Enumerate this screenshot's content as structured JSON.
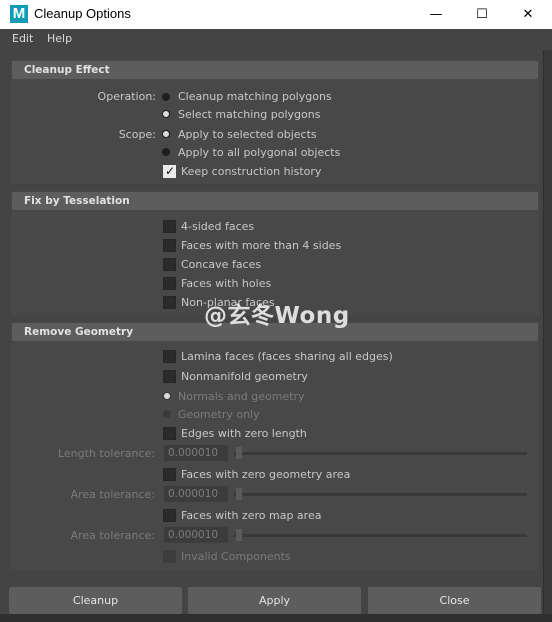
{
  "window": {
    "app_icon_letter": "M",
    "title": "Cleanup Options",
    "minimize_glyph": "—",
    "maximize_glyph": "☐",
    "close_glyph": "✕"
  },
  "menu": {
    "edit": "Edit",
    "help": "Help"
  },
  "cleanup_effect": {
    "header": "Cleanup Effect",
    "operation_label": "Operation:",
    "operation_options": [
      {
        "label": "Cleanup matching polygons",
        "selected": false
      },
      {
        "label": "Select matching polygons",
        "selected": true
      }
    ],
    "scope_label": "Scope:",
    "scope_options": [
      {
        "label": "Apply to selected objects",
        "selected": true
      },
      {
        "label": "Apply to all polygonal objects",
        "selected": false
      }
    ],
    "keep_history": {
      "label": "Keep construction history",
      "checked": true
    }
  },
  "fix_by_tesselation": {
    "header": "Fix by Tesselation",
    "options": [
      {
        "label": "4-sided faces",
        "checked": false
      },
      {
        "label": "Faces with more than 4 sides",
        "checked": false
      },
      {
        "label": "Concave faces",
        "checked": false
      },
      {
        "label": "Faces with holes",
        "checked": false
      },
      {
        "label": "Non-planar faces",
        "checked": false
      }
    ]
  },
  "remove_geometry": {
    "header": "Remove Geometry",
    "lamina": {
      "label": "Lamina faces (faces sharing all edges)",
      "checked": false
    },
    "nonmanifold": {
      "label": "Nonmanifold geometry",
      "checked": false
    },
    "nonmanifold_modes": [
      {
        "label": "Normals and geometry",
        "selected": true,
        "enabled": false
      },
      {
        "label": "Geometry only",
        "selected": false,
        "enabled": false
      }
    ],
    "zero_length": {
      "label": "Edges with zero length",
      "checked": false
    },
    "length_tolerance": {
      "label": "Length tolerance:",
      "value": "0.000010",
      "slider_fraction": 0
    },
    "zero_geometry_area": {
      "label": "Faces with zero geometry area",
      "checked": false
    },
    "geometry_area_tolerance": {
      "label": "Area tolerance:",
      "value": "0.000010",
      "slider_fraction": 0
    },
    "zero_map_area": {
      "label": "Faces with zero map area",
      "checked": false
    },
    "map_area_tolerance": {
      "label": "Area tolerance:",
      "value": "0.000010",
      "slider_fraction": 0
    },
    "invalid_components": {
      "label": "Invalid Components",
      "checked": false,
      "enabled": false
    }
  },
  "buttons": {
    "cleanup": "Cleanup",
    "apply": "Apply",
    "close": "Close"
  },
  "watermark": "@玄冬Wong"
}
